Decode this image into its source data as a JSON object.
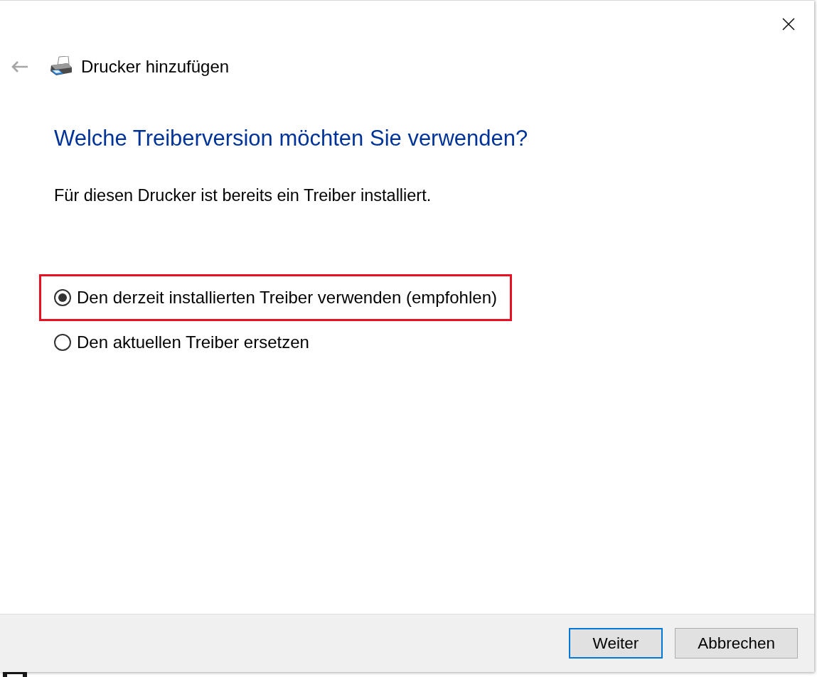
{
  "header": {
    "back_button": {
      "disabled": true
    },
    "title": "Drucker hinzufügen"
  },
  "heading": "Welche Treiberversion möchten Sie verwenden?",
  "description": "Für diesen Drucker ist bereits ein Treiber installiert.",
  "options": [
    {
      "label": "Den derzeit installierten Treiber verwenden (empfohlen)",
      "selected": true,
      "highlighted": true
    },
    {
      "label": "Den aktuellen Treiber ersetzen",
      "selected": false,
      "highlighted": false
    }
  ],
  "buttons": [
    {
      "label": "Weiter",
      "default": true
    },
    {
      "label": "Abbrechen",
      "default": false
    }
  ]
}
